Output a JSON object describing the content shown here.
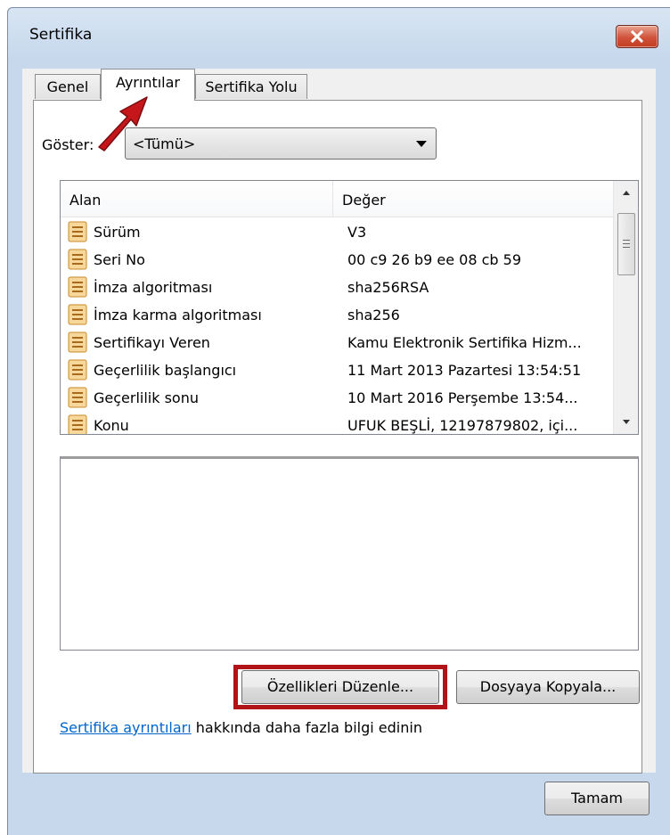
{
  "window": {
    "title": "Sertifika"
  },
  "tabs": [
    {
      "label": "Genel",
      "active": false
    },
    {
      "label": "Ayrıntılar",
      "active": true
    },
    {
      "label": "Sertifika Yolu",
      "active": false
    }
  ],
  "show": {
    "label": "Göster:",
    "selected": "<Tümü>"
  },
  "list": {
    "columns": [
      "Alan",
      "Değer"
    ],
    "rows": [
      {
        "field": "Sürüm",
        "value": "V3"
      },
      {
        "field": "Seri No",
        "value": "00 c9 26 b9 ee 08 cb 59"
      },
      {
        "field": "İmza algoritması",
        "value": "sha256RSA"
      },
      {
        "field": "İmza karma algoritması",
        "value": "sha256"
      },
      {
        "field": "Sertifikayı Veren",
        "value": "Kamu Elektronik Sertifika Hizm..."
      },
      {
        "field": "Geçerlilik başlangıcı",
        "value": "11 Mart 2013 Pazartesi 13:54:51"
      },
      {
        "field": "Geçerlilik sonu",
        "value": "10 Mart 2016 Perşembe 13:54..."
      },
      {
        "field": "Konu",
        "value": "UFUK BEŞLİ, 12197879802, içi..."
      }
    ]
  },
  "buttons": {
    "edit_properties": "Özellikleri Düzenle...",
    "copy_to_file": "Dosyaya Kopyala...",
    "ok": "Tamam"
  },
  "info": {
    "link": "Sertifika ayrıntıları",
    "text": " hakkında daha fazla bilgi edinin"
  },
  "icons": {
    "close": "close-icon",
    "field": "certificate-field-icon",
    "dropdown": "chevron-down-icon",
    "annotation": "red-arrow-annotation"
  },
  "colors": {
    "annotation_red": "#b01419",
    "link": "#0066cc",
    "close_button": "#c94a30"
  }
}
